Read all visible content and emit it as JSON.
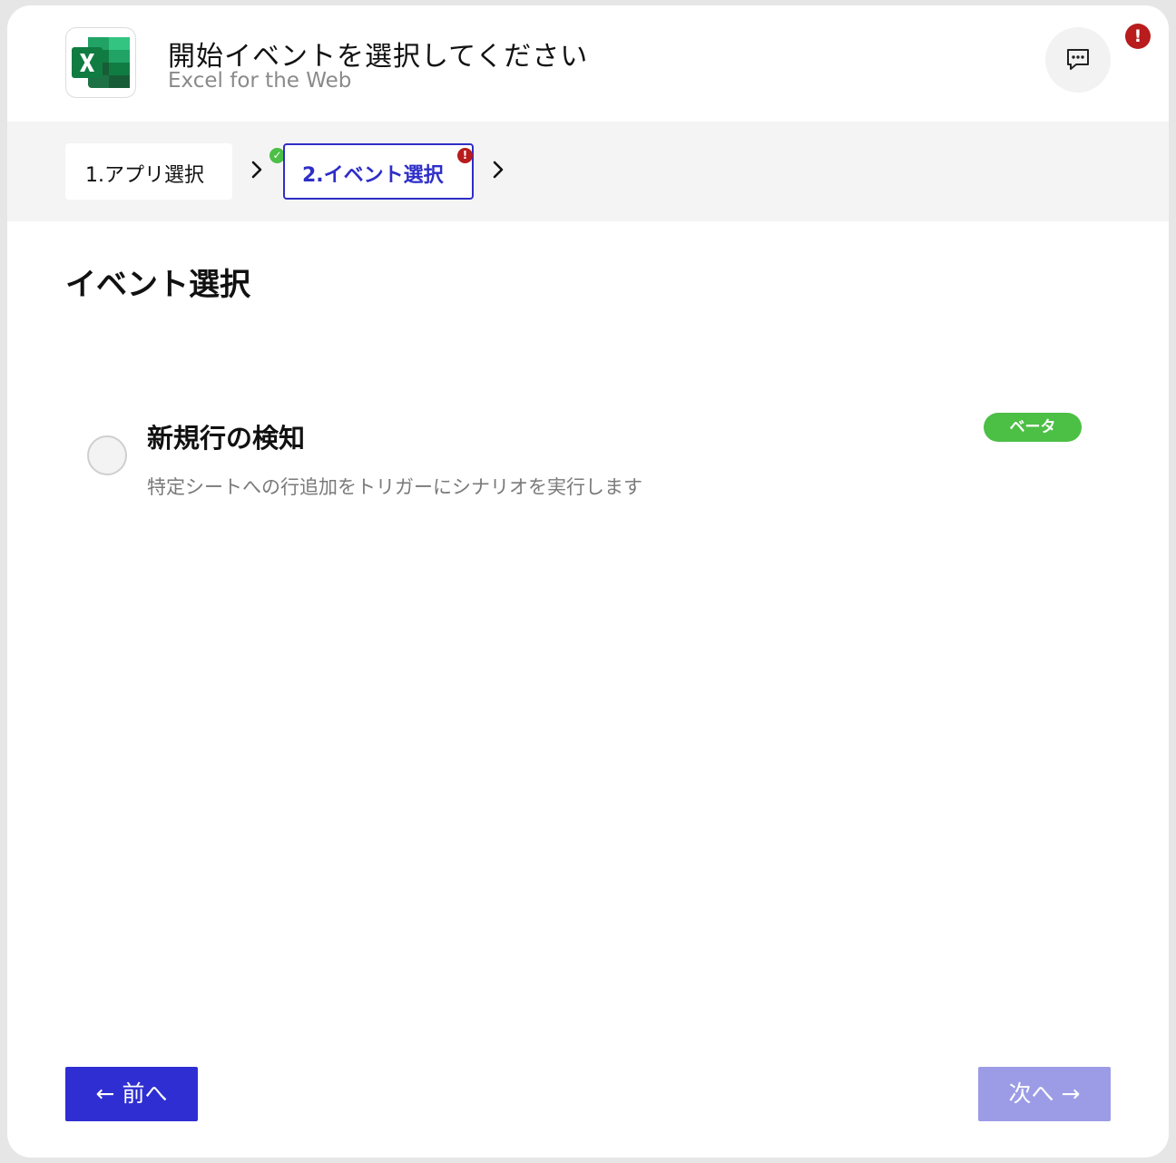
{
  "header": {
    "title": "開始イベントを選択してください",
    "subtitle": "Excel for the Web",
    "app_icon": "excel-icon",
    "chat_icon": "chat-bubble-icon",
    "alert_mark": "!"
  },
  "steps": [
    {
      "label": "1.アプリ選択",
      "status": "complete",
      "status_mark": "✓"
    },
    {
      "label": "2.イベント選択",
      "status": "error",
      "status_mark": "!"
    }
  ],
  "section": {
    "title": "イベント選択"
  },
  "events": [
    {
      "name": "新規行の検知",
      "description": "特定シートへの行追加をトリガーにシナリオを実行します",
      "badge": "ベータ",
      "selected": false
    }
  ],
  "footer": {
    "prev_label": "← 前へ",
    "next_label": "次へ →",
    "next_enabled": false
  },
  "colors": {
    "accent": "#2e2ed2",
    "accent_disabled": "#9c9ce6",
    "success": "#4bbf46",
    "error": "#b81c1c",
    "excel_green": "#1e7145"
  }
}
